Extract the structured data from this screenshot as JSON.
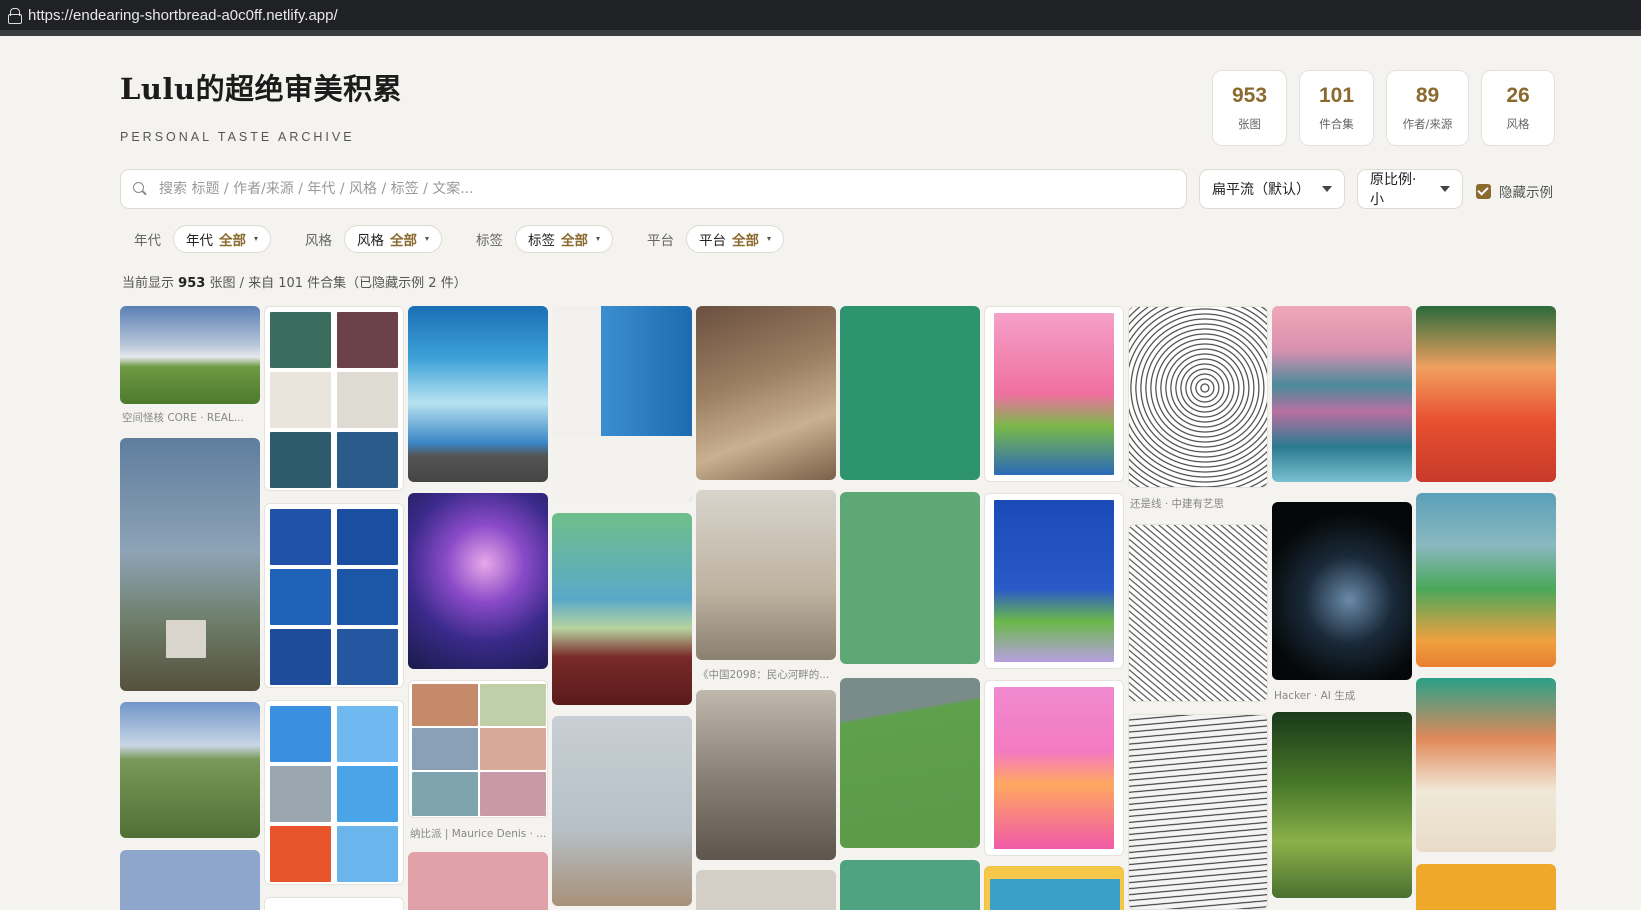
{
  "browser": {
    "url": "https://endearing-shortbread-a0c0ff.netlify.app/"
  },
  "header": {
    "title": "Lulu的超绝审美积累",
    "subtitle": "PERSONAL TASTE ARCHIVE"
  },
  "stats": [
    {
      "value": "953",
      "label": "张图"
    },
    {
      "value": "101",
      "label": "件合集"
    },
    {
      "value": "89",
      "label": "作者/来源"
    },
    {
      "value": "26",
      "label": "风格"
    }
  ],
  "search": {
    "placeholder": "搜索 标题 / 作者/来源 / 年代 / 风格 / 标签 / 文案..."
  },
  "controls": {
    "layout": "扁平流（默认）",
    "ratio": "原比例·小",
    "hide_examples": "隐藏示例"
  },
  "filters": [
    {
      "label": "年代",
      "chip": "年代",
      "value": "全部"
    },
    {
      "label": "风格",
      "chip": "风格",
      "value": "全部"
    },
    {
      "label": "标签",
      "chip": "标签",
      "value": "全部"
    },
    {
      "label": "平台",
      "chip": "平台",
      "value": "全部"
    }
  ],
  "summary": {
    "prefix": "当前显示",
    "count": "953",
    "rest": "张图 / 来自 101 件合集（已隐藏示例 2 件）"
  },
  "captions": {
    "c1": "空间怪核 CORE · REAL...",
    "c2": "还是线 · 中建有艺思",
    "c3": "《中国2098：民心河畔的...",
    "c4": "Hacker · AI 生成",
    "c5": "纳比派 | Maurice Denis · ..."
  }
}
